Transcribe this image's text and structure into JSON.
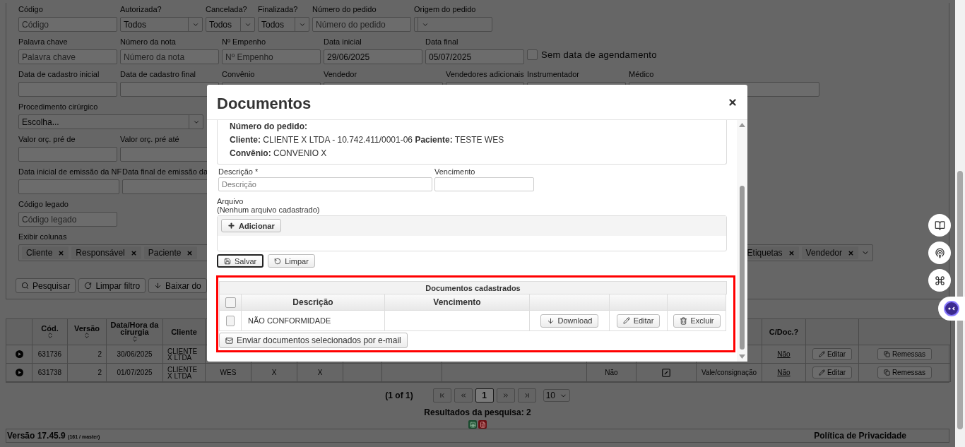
{
  "filters": [
    [
      {
        "label": "Código",
        "kind": "text",
        "placeholder": "Código"
      },
      {
        "label": "Autorizada?",
        "kind": "select",
        "value": "Todos"
      },
      {
        "label": "Cancelada?",
        "kind": "select",
        "value": "Todos"
      },
      {
        "label": "Finalizada?",
        "kind": "select",
        "value": "Todos"
      },
      {
        "label": "Número do pedido",
        "kind": "text",
        "placeholder": "Número do pedido"
      },
      {
        "label": "Origem do pedido",
        "kind": "select"
      }
    ],
    [
      {
        "label": "Palavra chave",
        "kind": "text",
        "placeholder": "Palavra chave"
      },
      {
        "label": "Número da nota",
        "kind": "text",
        "placeholder": "Número da nota"
      },
      {
        "label": "Nº Empenho",
        "kind": "text",
        "placeholder": "Nº Empenho"
      },
      {
        "label": "Data inicial",
        "kind": "text",
        "value": "29/06/2025"
      },
      {
        "label": "Data final",
        "kind": "text",
        "value": "05/07/2025"
      },
      {
        "label": "Sem data de agendamento",
        "kind": "checkbox",
        "checked": false
      }
    ],
    [
      {
        "label": "Data de cadastro inicial",
        "kind": "text"
      },
      {
        "label": "Data de cadastro final",
        "kind": "text"
      },
      {
        "label": "Convênio",
        "kind": "text"
      },
      {
        "label": "Vendedor",
        "kind": "text"
      },
      {
        "label": "Vendedores adicionais",
        "kind": "text"
      },
      {
        "label": "Instrumentador",
        "kind": "text"
      },
      {
        "label": "Médico",
        "kind": "text"
      }
    ],
    [
      {
        "label": "Procedimento cirúrgico",
        "kind": "select",
        "value": "Escolha..."
      }
    ],
    [
      {
        "label": "Valor orç. pré de",
        "kind": "text"
      },
      {
        "label": "Valor orç. pré até",
        "kind": "text"
      }
    ],
    [
      {
        "label": "Data inicial de emissão da NF",
        "kind": "text"
      },
      {
        "label": "Data final de emissão da",
        "kind": "text"
      }
    ],
    [
      {
        "label": "Código legado",
        "kind": "text",
        "placeholder": "Código legado"
      }
    ]
  ],
  "columns_filter": {
    "label": "Exibir colunas",
    "tags_left": [
      "Cliente",
      "Responsável",
      "Paciente"
    ],
    "tags_right": [
      "Etiquetas",
      "Vendedor"
    ]
  },
  "filter_buttons": [
    {
      "kind": "search",
      "label": "Pesquisar"
    },
    {
      "kind": "reset",
      "label": "Limpar filtro"
    },
    {
      "kind": "download",
      "label": "Baixar do"
    }
  ],
  "results": {
    "columns": [
      {
        "sortable": false
      },
      {
        "label": "Cód.",
        "sortable": true
      },
      {
        "label": "Versão",
        "sortable": true
      },
      {
        "label": "Data/Hora da cirurgia",
        "sortable": true
      },
      {
        "label": "Cliente",
        "sortable": false
      },
      {},
      {},
      {},
      {},
      {},
      {},
      {},
      {},
      {},
      {
        "label": "C/Doc.?",
        "sortable": false
      },
      {
        "sortable": false
      },
      {
        "sortable": false
      }
    ],
    "rows": [
      {
        "cells": [
          {
            "kind": "expand"
          },
          {
            "kind": "text",
            "text": "631736"
          },
          {
            "kind": "number",
            "text": "2"
          },
          {
            "kind": "text",
            "text": "30/06/2025"
          },
          {
            "kind": "text",
            "text": "CLIENTE X LTDA"
          },
          {
            "kind": "empty"
          },
          {
            "kind": "empty"
          },
          {
            "kind": "empty"
          },
          {
            "kind": "empty"
          },
          {
            "kind": "empty"
          },
          {
            "kind": "empty"
          },
          {
            "kind": "empty"
          },
          {
            "kind": "empty"
          },
          {
            "kind": "empty"
          },
          {
            "kind": "link",
            "text": "Não"
          },
          {
            "kind": "edit",
            "text": "Editar"
          },
          {
            "kind": "shipments",
            "text": "Remessas"
          }
        ]
      },
      {
        "cells": [
          {
            "kind": "expand"
          },
          {
            "kind": "text",
            "text": "631738"
          },
          {
            "kind": "number",
            "text": "2"
          },
          {
            "kind": "text",
            "text": "01/07/2025"
          },
          {
            "kind": "text",
            "text": "CLIENTE X LTDA"
          },
          {
            "kind": "text",
            "text": "WES"
          },
          {
            "kind": "text",
            "text": "X"
          },
          {
            "kind": "text",
            "text": "X"
          },
          {
            "kind": "empty"
          },
          {
            "kind": "empty"
          },
          {
            "kind": "empty"
          },
          {
            "kind": "text",
            "text": "Não"
          },
          {
            "kind": "doc"
          },
          {
            "kind": "text",
            "text": "Vale/consignação"
          },
          {
            "kind": "link",
            "text": "Não"
          },
          {
            "kind": "edit",
            "text": "Editar"
          },
          {
            "kind": "shipments",
            "text": "Remessas"
          }
        ]
      }
    ]
  },
  "pagination": {
    "summary": "(1 of 1)",
    "pages": [
      {
        "label": "1",
        "selected": true
      }
    ],
    "page_size": "10"
  },
  "results_count": "Resultados da pesquisa: 2",
  "footer": {
    "version": "Versão 17.45.9",
    "build": "(161 / master)",
    "privacy": "Política de Privacidade"
  },
  "modal": {
    "title": "Documentos",
    "info": [
      [
        {
          "label": "Número do pedido:"
        }
      ],
      [
        {
          "label": "Cliente:",
          "value": "CLIENTE X LTDA - 10.742.411/0001-06"
        },
        {
          "label": "Paciente:",
          "value": "TESTE WES"
        }
      ],
      [
        {
          "label": "Convênio:",
          "value": "CONVENIO X"
        }
      ]
    ],
    "description": {
      "label": "Descrição *",
      "placeholder": "Descrição"
    },
    "due": {
      "label": "Vencimento"
    },
    "file": {
      "label": "Arquivo",
      "status": "(Nenhum arquivo cadastrado)",
      "add_button": "Adicionar"
    },
    "save_button": "Salvar",
    "clear_button": "Limpar",
    "documents": {
      "title": "Documentos cadastrados",
      "header_checked": false,
      "columns": [
        "Descrição",
        "Vencimento"
      ],
      "rows": [
        {
          "checked": false,
          "description": "NÃO CONFORMIDADE",
          "actions": [
            {
              "kind": "download",
              "label": "Download"
            },
            {
              "kind": "edit",
              "label": "Editar"
            },
            {
              "kind": "delete",
              "label": "Excluir"
            }
          ]
        }
      ],
      "email_button": "Enviar documentos selecionados por e-mail"
    }
  }
}
